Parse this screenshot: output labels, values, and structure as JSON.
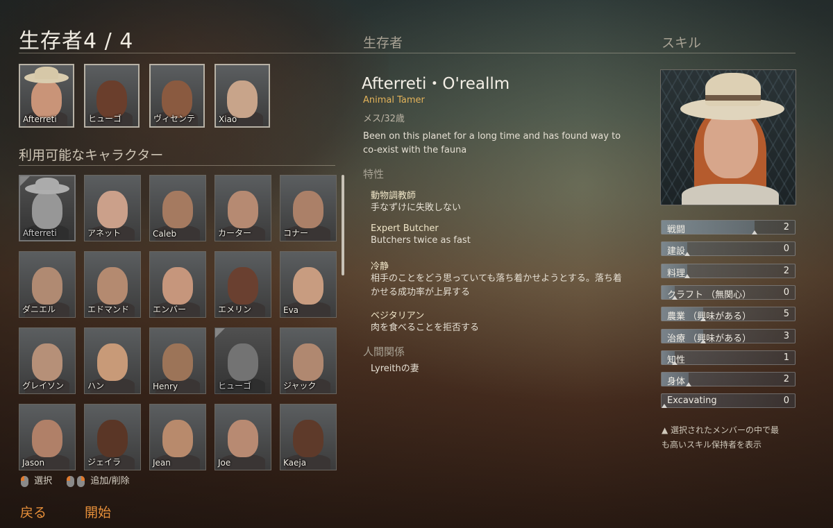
{
  "header": {
    "title": "生存者4 / 4"
  },
  "party": [
    {
      "name": "Afterreti",
      "skin": "#c99478",
      "hat": true
    },
    {
      "name": "ヒューゴ",
      "skin": "#6a3e2c",
      "hat": false
    },
    {
      "name": "ヴィセンテ",
      "skin": "#8a5a40",
      "hat": false
    },
    {
      "name": "Xiao",
      "skin": "#c8a48a",
      "hat": false
    }
  ],
  "available": {
    "title": "利用可能なキャラクター",
    "characters": [
      {
        "name": "Afterreti",
        "skin": "#b8b0a8"
      },
      {
        "name": "アネット",
        "skin": "#cba08a"
      },
      {
        "name": "Caleb",
        "skin": "#a57a60"
      },
      {
        "name": "カーター",
        "skin": "#b68a72"
      },
      {
        "name": "コナー",
        "skin": "#ab8068"
      },
      {
        "name": "ダニエル",
        "skin": "#b08a72"
      },
      {
        "name": "エドマンド",
        "skin": "#b48a70"
      },
      {
        "name": "エンバー",
        "skin": "#c6967c"
      },
      {
        "name": "エメリン",
        "skin": "#6a4030"
      },
      {
        "name": "Eva",
        "skin": "#c89c80"
      },
      {
        "name": "グレイソン",
        "skin": "#b69078"
      },
      {
        "name": "ハン",
        "skin": "#c89a78"
      },
      {
        "name": "Henry",
        "skin": "#9c7458"
      },
      {
        "name": "ヒューゴ",
        "skin": "#8a8684"
      },
      {
        "name": "ジャック",
        "skin": "#b08870"
      },
      {
        "name": "Jason",
        "skin": "#b08068"
      },
      {
        "name": "ジェイラ",
        "skin": "#5a3626"
      },
      {
        "name": "Jean",
        "skin": "#b88a6c"
      },
      {
        "name": "Joe",
        "skin": "#b88a72"
      },
      {
        "name": "Kaeja",
        "skin": "#5e3a2a"
      }
    ]
  },
  "controls": {
    "select_label": "選択",
    "add_remove_label": "追加/削除",
    "back_label": "戻る",
    "start_label": "開始"
  },
  "survivor": {
    "section_title": "生存者",
    "name": "Afterreti・O'reallm",
    "role": "Animal Tamer",
    "meta": "メス/32歳",
    "description_line1": "Been on this planet for a long time and has found way to",
    "description_line2": "co-exist with the fauna",
    "traits_title": "特性",
    "traits": [
      {
        "name": "動物調教師",
        "desc1": "手なずけに失敗しない",
        "desc2": ""
      },
      {
        "name": "Expert Butcher",
        "desc1": "Butchers twice as fast",
        "desc2": ""
      },
      {
        "name": "冷静",
        "desc1": "相手のことをどう思っていても落ち着かせようとする。落ち着",
        "desc2": "かせる成功率が上昇する"
      },
      {
        "name": "ベジタリアン",
        "desc1": "肉を食べることを拒否する",
        "desc2": ""
      }
    ],
    "relations_title": "人間関係",
    "relations": [
      "Lyreithの妻"
    ]
  },
  "skills": {
    "section_title": "スキル",
    "items": [
      {
        "label": "戦闘",
        "value": "2",
        "level": 0.69
      },
      {
        "label": "建設",
        "value": "0",
        "level": 0.19
      },
      {
        "label": "料理",
        "value": "2",
        "level": 0.19
      },
      {
        "label": "クラフト （無関心）",
        "value": "0",
        "level": 0.1
      },
      {
        "label": "農業 （興味がある）",
        "value": "5",
        "level": 0.31
      },
      {
        "label": "治療 （興味がある）",
        "value": "3",
        "level": 0.31
      },
      {
        "label": "知性",
        "value": "1",
        "level": 0.1
      },
      {
        "label": "身体",
        "value": "2",
        "level": 0.2
      },
      {
        "label": "Excavating",
        "value": "0",
        "level": 0.0
      }
    ],
    "note_line1": "▲ 選択されたメンバーの中で最",
    "note_line2": "も高いスキル保持者を表示"
  }
}
